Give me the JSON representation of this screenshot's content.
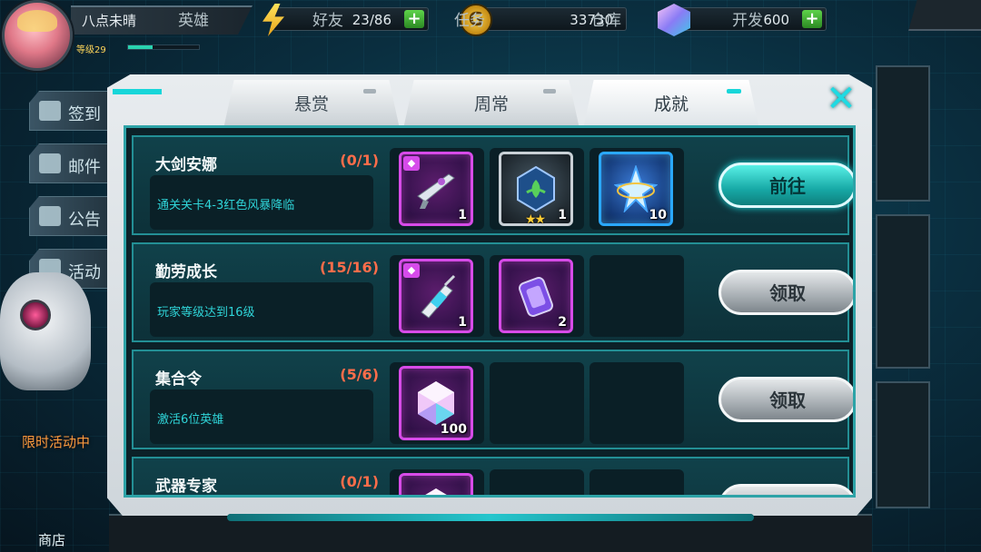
{
  "player": {
    "name": "八点未晴",
    "level_label": "等级29"
  },
  "resources": {
    "energy": "23/86",
    "gold": "33730",
    "gems": "600",
    "plus": "+"
  },
  "coin_symbol": "G",
  "side_menu": [
    {
      "label": "签到",
      "icon": "rabbit-icon"
    },
    {
      "label": "邮件",
      "icon": "mail-icon"
    },
    {
      "label": "公告",
      "icon": "megaphone-icon"
    },
    {
      "label": "活动",
      "icon": "trophy-icon"
    }
  ],
  "limited_event": "限时活动中",
  "shop": "商店",
  "bottom_nav": [
    "英雄",
    "好友",
    "任务",
    "仓库",
    "开发"
  ],
  "tabs": [
    {
      "label": "悬赏",
      "active": false
    },
    {
      "label": "周常",
      "active": false
    },
    {
      "label": "成就",
      "active": true
    }
  ],
  "close_symbol": "✕",
  "quests": [
    {
      "title": "大剑安娜",
      "progress": "(0/1)",
      "desc": "通关关卡4-3红色风暴降临",
      "rewards": [
        {
          "name": "sniper-rifle",
          "qty": "1",
          "rarity": "purple",
          "badge": true
        },
        {
          "name": "hero-emblem",
          "qty": "1",
          "rarity": "gray",
          "stars": "★★"
        },
        {
          "name": "crystal-star",
          "qty": "10",
          "rarity": "blue"
        }
      ],
      "button": "前往",
      "button_type": "go"
    },
    {
      "title": "勤劳成长",
      "progress": "(15/16)",
      "desc": "玩家等级达到16级",
      "rewards": [
        {
          "name": "syringe-weapon",
          "qty": "1",
          "rarity": "purple",
          "badge": true
        },
        {
          "name": "energy-canister",
          "qty": "2",
          "rarity": "purple"
        }
      ],
      "button": "领取",
      "button_type": "claim"
    },
    {
      "title": "集合令",
      "progress": "(5/6)",
      "desc": "激活6位英雄",
      "rewards": [
        {
          "name": "gem",
          "qty": "100",
          "rarity": "purple"
        }
      ],
      "button": "领取",
      "button_type": "claim"
    },
    {
      "title": "武器专家",
      "progress": "(0/1)",
      "desc": "",
      "rewards": [
        {
          "name": "gem",
          "qty": "",
          "rarity": "purple"
        }
      ],
      "button": "",
      "button_type": "claim"
    }
  ],
  "colors": {
    "accent": "#18d6d9",
    "progress_red": "#ff6d4a",
    "desc_cyan": "#2fd4d8",
    "rarity_purple": "#d74be8",
    "rarity_blue": "#2aa8ff"
  }
}
